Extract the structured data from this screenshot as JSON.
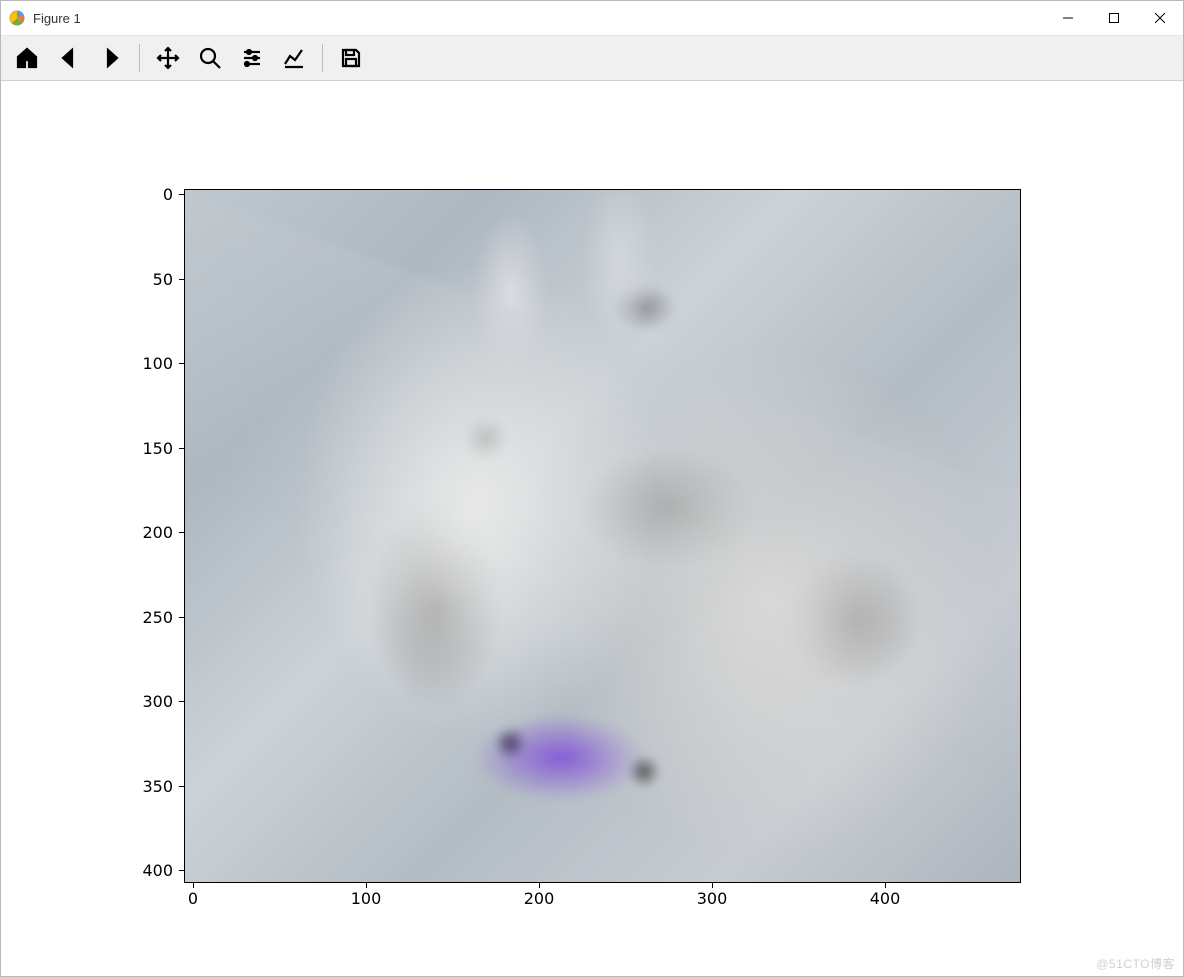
{
  "window": {
    "title": "Figure 1"
  },
  "toolbar": {
    "home": "Home",
    "back": "Back",
    "forward": "Forward",
    "pan": "Pan",
    "zoom": "Zoom",
    "subplots": "Configure subplots",
    "axes": "Edit axis",
    "save": "Save"
  },
  "chart_data": {
    "type": "image",
    "description": "Semi-transparent composite of two blended photographs of a terrier dog on a stone/concrete surface, one view rotated relative to the other. Predominantly light gray-blue tones with a purple collar visible near the lower-left region.",
    "x_range": [
      0,
      480
    ],
    "y_range": [
      0,
      410
    ],
    "y_inverted": true,
    "x_ticks": [
      0,
      100,
      200,
      300,
      400
    ],
    "y_ticks": [
      0,
      50,
      100,
      150,
      200,
      250,
      300,
      350,
      400
    ],
    "xlabel": "",
    "ylabel": "",
    "title": ""
  },
  "ticks": {
    "y": [
      "0",
      "50",
      "100",
      "150",
      "200",
      "250",
      "300",
      "350",
      "400"
    ],
    "x": [
      "0",
      "100",
      "200",
      "300",
      "400"
    ]
  },
  "watermark": "@51CTO博客"
}
